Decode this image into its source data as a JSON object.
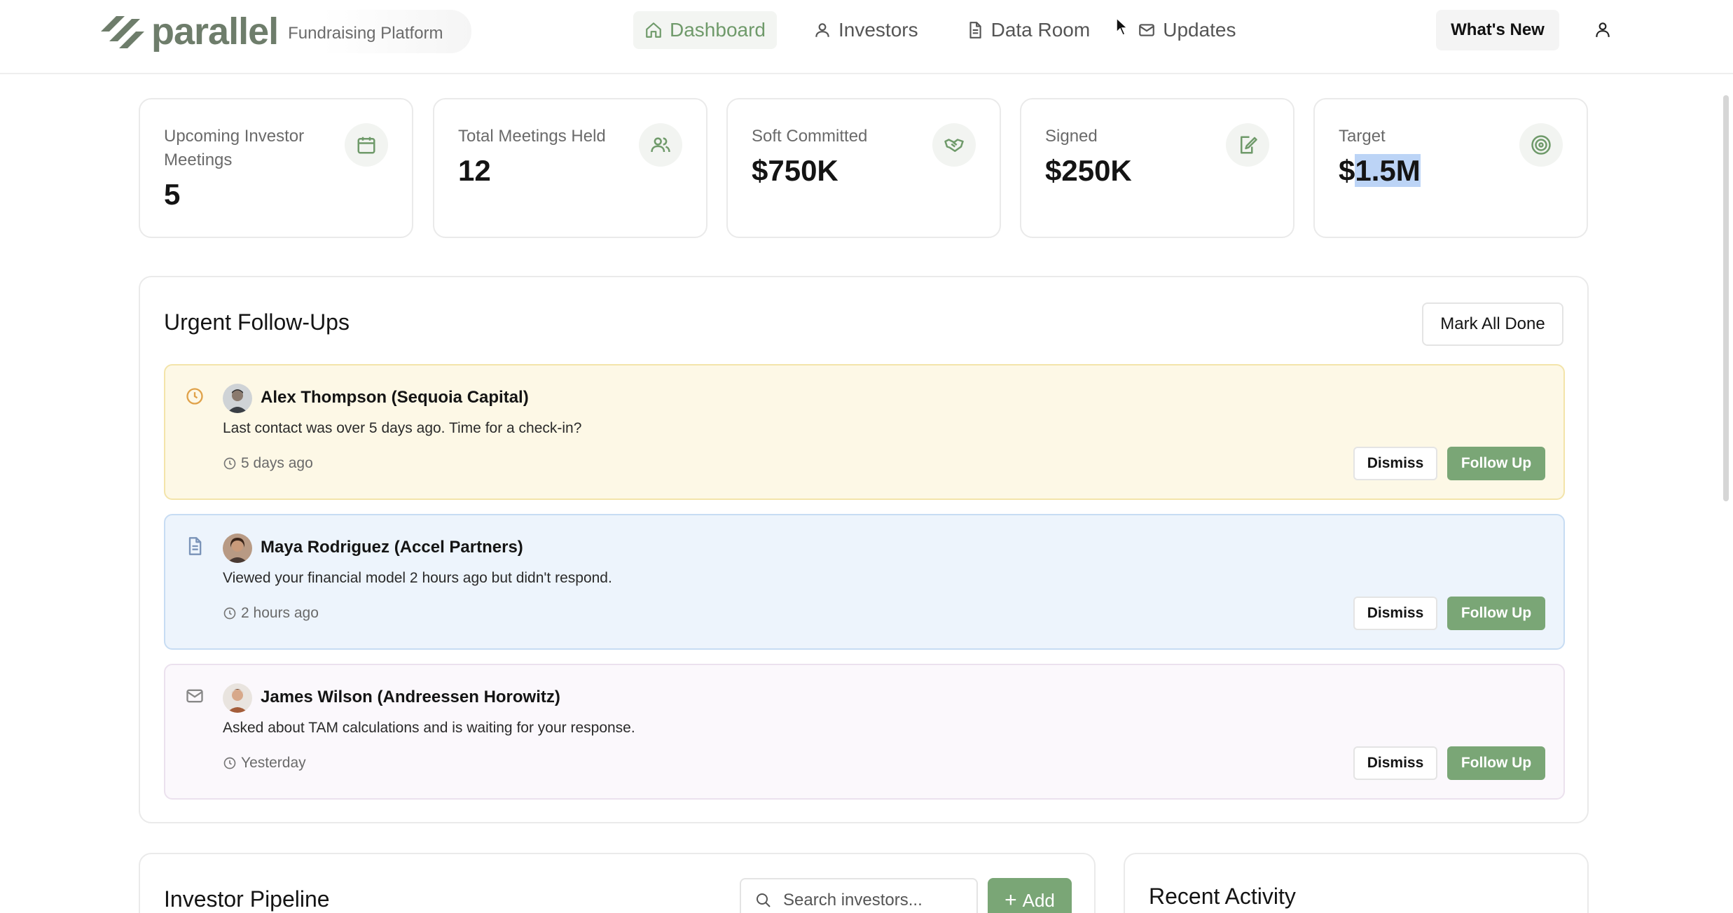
{
  "header": {
    "logo_text": "parallel",
    "logo_subtitle": "Fundraising Platform",
    "nav": [
      {
        "label": "Dashboard",
        "icon": "home-icon",
        "active": true
      },
      {
        "label": "Investors",
        "icon": "user-icon",
        "active": false
      },
      {
        "label": "Data Room",
        "icon": "document-icon",
        "active": false
      },
      {
        "label": "Updates",
        "icon": "mail-icon",
        "active": false
      }
    ],
    "whats_new": "What's New",
    "user_icon": "user-icon"
  },
  "stats": [
    {
      "label": "Upcoming Investor Meetings",
      "value": "5",
      "icon": "calendar-icon"
    },
    {
      "label": "Total Meetings Held",
      "value": "12",
      "icon": "users-icon"
    },
    {
      "label": "Soft Committed",
      "value": "$750K",
      "icon": "handshake-icon"
    },
    {
      "label": "Signed",
      "value": "$250K",
      "icon": "signature-icon"
    },
    {
      "label": "Target",
      "value_prefix": "$",
      "value_selected": "1.5M",
      "icon": "target-icon"
    }
  ],
  "followups": {
    "title": "Urgent Follow-Ups",
    "mark_all_label": "Mark All Done",
    "items": [
      {
        "name": "Alex Thompson (Sequoia Capital)",
        "message": "Last contact was over 5 days ago. Time for a check-in?",
        "time": "5 days ago",
        "type_icon": "clock-icon",
        "dismiss": "Dismiss",
        "follow_up": "Follow Up"
      },
      {
        "name": "Maya Rodriguez (Accel Partners)",
        "message": "Viewed your financial model 2 hours ago but didn't respond.",
        "time": "2 hours ago",
        "type_icon": "document-icon",
        "dismiss": "Dismiss",
        "follow_up": "Follow Up"
      },
      {
        "name": "James Wilson (Andreessen Horowitz)",
        "message": "Asked about TAM calculations and is waiting for your response.",
        "time": "Yesterday",
        "type_icon": "mail-icon",
        "dismiss": "Dismiss",
        "follow_up": "Follow Up"
      }
    ]
  },
  "pipeline": {
    "title": "Investor Pipeline",
    "search_placeholder": "Search investors...",
    "add_label": "Add"
  },
  "activity": {
    "title": "Recent Activity"
  },
  "colors": {
    "brand": "#6e7d6b",
    "accent_green": "#7aa676",
    "followup_warning_bg": "#fdf8e6",
    "followup_info_bg": "#edf4fc",
    "followup_message_bg": "#fbf8fc"
  }
}
